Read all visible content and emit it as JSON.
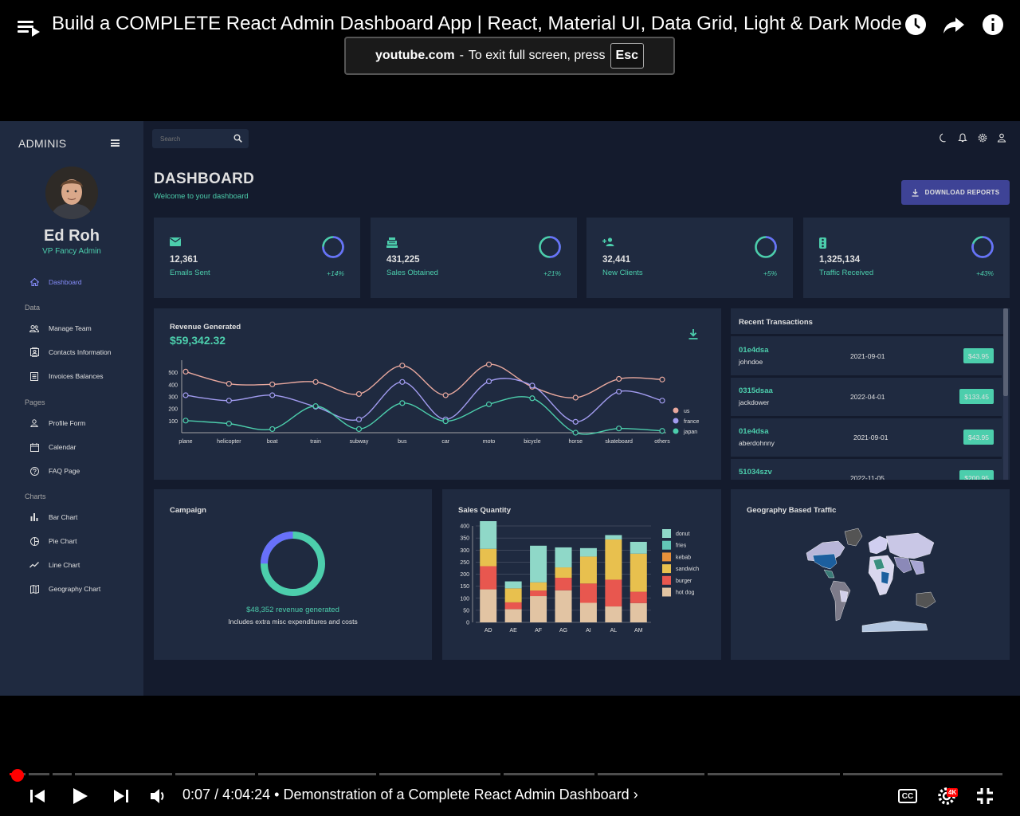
{
  "youtube": {
    "video_title": "Build a COMPLETE React Admin Dashboard App | React, Material UI, Data Grid, Light & Dark Mode",
    "fullscreen_notice": {
      "site": "youtube.com",
      "separator": "-",
      "message": "To exit full screen, press",
      "key": "Esc"
    },
    "time_current": "0:07",
    "time_total": "4:04:24",
    "chapter": "Demonstration of a Complete React Admin Dashboard",
    "quality_badge": "4K",
    "cc_label": "CC",
    "progress": 0.0005
  },
  "sidebar": {
    "brand": "ADMINIS",
    "user_name": "Ed Roh",
    "user_role": "VP Fancy Admin",
    "items": [
      {
        "label": "Dashboard",
        "icon": "home-icon",
        "active": true
      },
      {
        "section": "Data"
      },
      {
        "label": "Manage Team",
        "icon": "people-icon"
      },
      {
        "label": "Contacts Information",
        "icon": "contacts-icon"
      },
      {
        "label": "Invoices Balances",
        "icon": "receipt-icon"
      },
      {
        "section": "Pages"
      },
      {
        "label": "Profile Form",
        "icon": "person-icon"
      },
      {
        "label": "Calendar",
        "icon": "calendar-icon"
      },
      {
        "label": "FAQ Page",
        "icon": "help-icon"
      },
      {
        "section": "Charts"
      },
      {
        "label": "Bar Chart",
        "icon": "bar-chart-icon"
      },
      {
        "label": "Pie Chart",
        "icon": "pie-chart-icon"
      },
      {
        "label": "Line Chart",
        "icon": "timeline-icon"
      },
      {
        "label": "Geography Chart",
        "icon": "map-icon"
      }
    ]
  },
  "topbar": {
    "search_placeholder": "Search",
    "icons": [
      "dark-mode-icon",
      "notifications-icon",
      "settings-icon",
      "person-icon"
    ]
  },
  "header": {
    "title": "DASHBOARD",
    "subtitle": "Welcome to your dashboard",
    "download_label": "DOWNLOAD REPORTS"
  },
  "stats": [
    {
      "value": "12,361",
      "label": "Emails Sent",
      "increase": "+14%",
      "progress": 0.75,
      "icon": "email-icon"
    },
    {
      "value": "431,225",
      "label": "Sales Obtained",
      "increase": "+21%",
      "progress": 0.5,
      "icon": "point-of-sale-icon"
    },
    {
      "value": "32,441",
      "label": "New Clients",
      "increase": "+5%",
      "progress": 0.3,
      "icon": "person-add-icon"
    },
    {
      "value": "1,325,134",
      "label": "Traffic Received",
      "increase": "+43%",
      "progress": 0.8,
      "icon": "traffic-icon"
    }
  ],
  "revenue": {
    "title": "Revenue Generated",
    "value": "$59,342.32"
  },
  "transactions": {
    "title": "Recent Transactions",
    "rows": [
      {
        "id": "01e4dsa",
        "user": "johndoe",
        "date": "2021-09-01",
        "cost": "$43.95"
      },
      {
        "id": "0315dsaa",
        "user": "jackdower",
        "date": "2022-04-01",
        "cost": "$133.45"
      },
      {
        "id": "01e4dsa",
        "user": "aberdohnny",
        "date": "2021-09-01",
        "cost": "$43.95"
      },
      {
        "id": "51034szv",
        "user": "",
        "date": "2022-11-05",
        "cost": "$200.95"
      }
    ]
  },
  "campaign": {
    "title": "Campaign",
    "revenue_text": "$48,352 revenue generated",
    "note": "Includes extra misc expenditures and costs",
    "progress": 0.75
  },
  "sales": {
    "title": "Sales Quantity"
  },
  "geo": {
    "title": "Geography Based Traffic"
  },
  "colors": {
    "background": "#141b2d",
    "panel": "#1f2a40",
    "accent_green": "#4cceac",
    "accent_blue": "#6870fa",
    "button": "#3e4396"
  },
  "chart_data": [
    {
      "type": "line",
      "title": "Revenue Generated",
      "categories": [
        "plane",
        "helicopter",
        "boat",
        "train",
        "subway",
        "bus",
        "car",
        "moto",
        "bicycle",
        "horse",
        "skateboard",
        "others"
      ],
      "yticks": [
        100,
        200,
        300,
        400,
        500
      ],
      "ylim": [
        0,
        600
      ],
      "legend": "right",
      "series": [
        {
          "name": "us",
          "color": "#e8a89e",
          "values": [
            505,
            405,
            400,
            420,
            320,
            555,
            310,
            565,
            380,
            290,
            445,
            440
          ]
        },
        {
          "name": "france",
          "color": "#a29cf0",
          "values": [
            310,
            265,
            310,
            215,
            110,
            420,
            110,
            425,
            390,
            90,
            340,
            265
          ]
        },
        {
          "name": "japan",
          "color": "#4cceac",
          "values": [
            100,
            75,
            30,
            220,
            30,
            245,
            95,
            235,
            285,
            0,
            35,
            15
          ]
        }
      ]
    },
    {
      "type": "bar",
      "stacked": true,
      "title": "Sales Quantity",
      "categories": [
        "AD",
        "AE",
        "AF",
        "AG",
        "AI",
        "AL",
        "AM"
      ],
      "yticks": [
        0,
        50,
        100,
        150,
        200,
        250,
        300,
        350,
        400
      ],
      "ylim": [
        0,
        400
      ],
      "legend": "right",
      "series": [
        {
          "name": "hot dog",
          "color": "#e2c4a3",
          "values": [
            137,
            55,
            109,
            133,
            81,
            66,
            80
          ]
        },
        {
          "name": "burger",
          "color": "#e8574f",
          "values": [
            96,
            28,
            23,
            52,
            80,
            111,
            47
          ]
        },
        {
          "name": "sandwich",
          "color": "#e8c04e",
          "values": [
            72,
            58,
            34,
            43,
            112,
            167,
            158
          ]
        },
        {
          "name": "kebab",
          "color": "#e8913b",
          "values": [
            0,
            0,
            0,
            0,
            0,
            0,
            0
          ]
        },
        {
          "name": "fries",
          "color": "#62c6b6",
          "values": [
            0,
            0,
            0,
            0,
            0,
            0,
            0
          ]
        },
        {
          "name": "donut",
          "color": "#8fd8c8",
          "values": [
            140,
            29,
            152,
            83,
            35,
            18,
            49
          ]
        }
      ]
    }
  ]
}
